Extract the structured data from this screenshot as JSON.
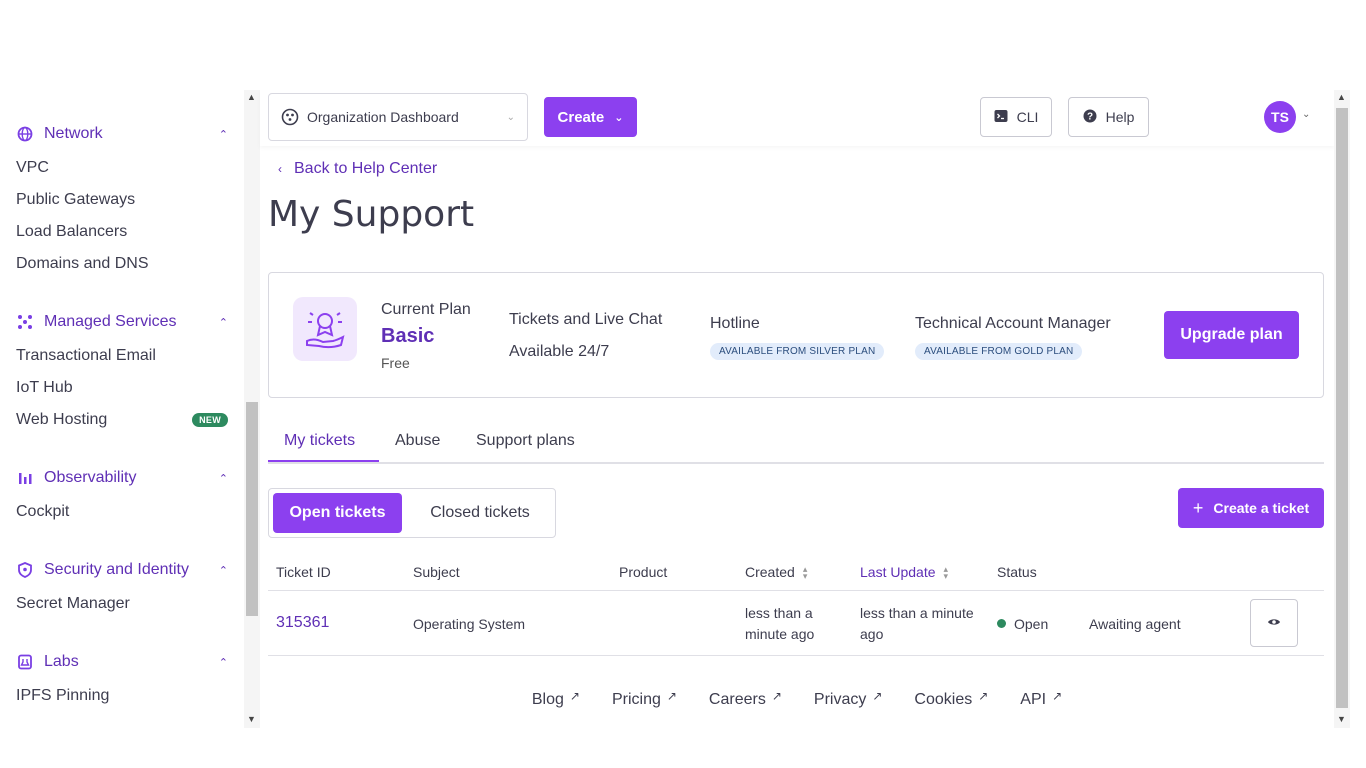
{
  "sidebar": {
    "sections": [
      {
        "title": "Network",
        "icon": "globe-icon",
        "items": [
          "VPC",
          "Public Gateways",
          "Load Balancers",
          "Domains and DNS"
        ]
      },
      {
        "title": "Managed Services",
        "icon": "services-icon",
        "items": [
          "Transactional Email",
          "IoT Hub",
          "Web Hosting"
        ]
      },
      {
        "title": "Observability",
        "icon": "bar-chart-icon",
        "items": [
          "Cockpit"
        ]
      },
      {
        "title": "Security and Identity",
        "icon": "shield-icon",
        "items": [
          "Secret Manager"
        ]
      },
      {
        "title": "Labs",
        "icon": "flask-icon",
        "items": [
          "IPFS Pinning"
        ]
      }
    ],
    "new_badge": "NEW"
  },
  "topbar": {
    "org_select": "Organization Dashboard",
    "create_label": "Create",
    "cli_label": "CLI",
    "help_label": "Help",
    "avatar_initials": "TS"
  },
  "main": {
    "back_link": "Back to Help Center",
    "page_title": "My Support",
    "plan": {
      "current_plan_label": "Current Plan",
      "plan_name": "Basic",
      "plan_price": "Free",
      "tickets_label": "Tickets and Live Chat",
      "tickets_value": "Available 24/7",
      "hotline_label": "Hotline",
      "hotline_badge": "AVAILABLE FROM SILVER PLAN",
      "tam_label": "Technical Account Manager",
      "tam_badge": "AVAILABLE FROM GOLD PLAN",
      "upgrade_label": "Upgrade plan"
    },
    "tabs": [
      "My tickets",
      "Abuse",
      "Support plans"
    ],
    "active_tab": "My tickets",
    "toggle": {
      "open": "Open tickets",
      "closed": "Closed tickets"
    },
    "create_ticket_label": "Create a ticket",
    "table": {
      "headers": [
        "Ticket ID",
        "Subject",
        "Product",
        "Created",
        "Last Update",
        "Status"
      ],
      "rows": [
        {
          "id": "315361",
          "subject": "Operating System",
          "product": "",
          "created": "less than a minute ago",
          "last_update": "less than a minute ago",
          "status": "Open",
          "detail": "Awaiting agent"
        }
      ]
    },
    "footer": [
      "Blog",
      "Pricing",
      "Careers",
      "Privacy",
      "Cookies",
      "API"
    ]
  },
  "colors": {
    "accent": "#8c40ef",
    "accent_text": "#5f2fb5",
    "status_open": "#2d8a5f"
  }
}
